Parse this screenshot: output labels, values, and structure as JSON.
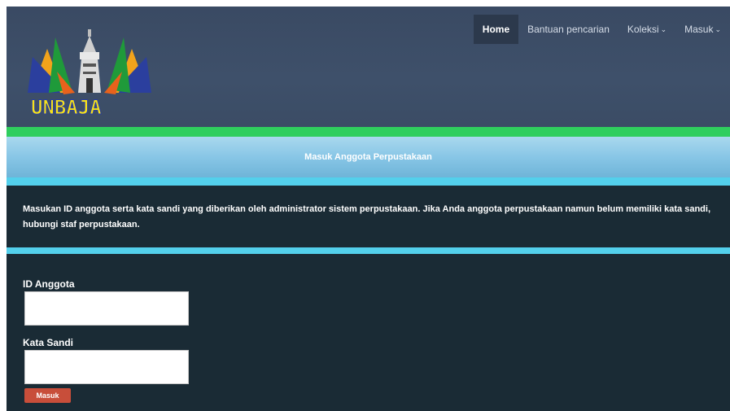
{
  "logo": {
    "text": "UNBAJA"
  },
  "nav": {
    "items": [
      {
        "label": "Home",
        "active": true
      },
      {
        "label": "Bantuan pencarian"
      },
      {
        "label": "Koleksi",
        "dropdown": true
      },
      {
        "label": "Masuk",
        "dropdown": true
      }
    ]
  },
  "page": {
    "title": "Masuk Anggota Perpustakaan",
    "info": "Masukan ID anggota serta kata sandi yang diberikan oleh administrator sistem perpustakaan. Jika Anda anggota perpustakaan namun belum memiliki kata sandi, hubungi staf perpustakaan."
  },
  "form": {
    "id_label": "ID Anggota",
    "id_value": "",
    "password_label": "Kata Sandi",
    "password_value": "",
    "submit_label": "Masuk"
  },
  "colors": {
    "header": "#3e506a",
    "green_stripe": "#2fce5e",
    "cyan_stripe": "#53d0ec",
    "content_bg": "#1a2b35",
    "button": "#c84e3a"
  }
}
